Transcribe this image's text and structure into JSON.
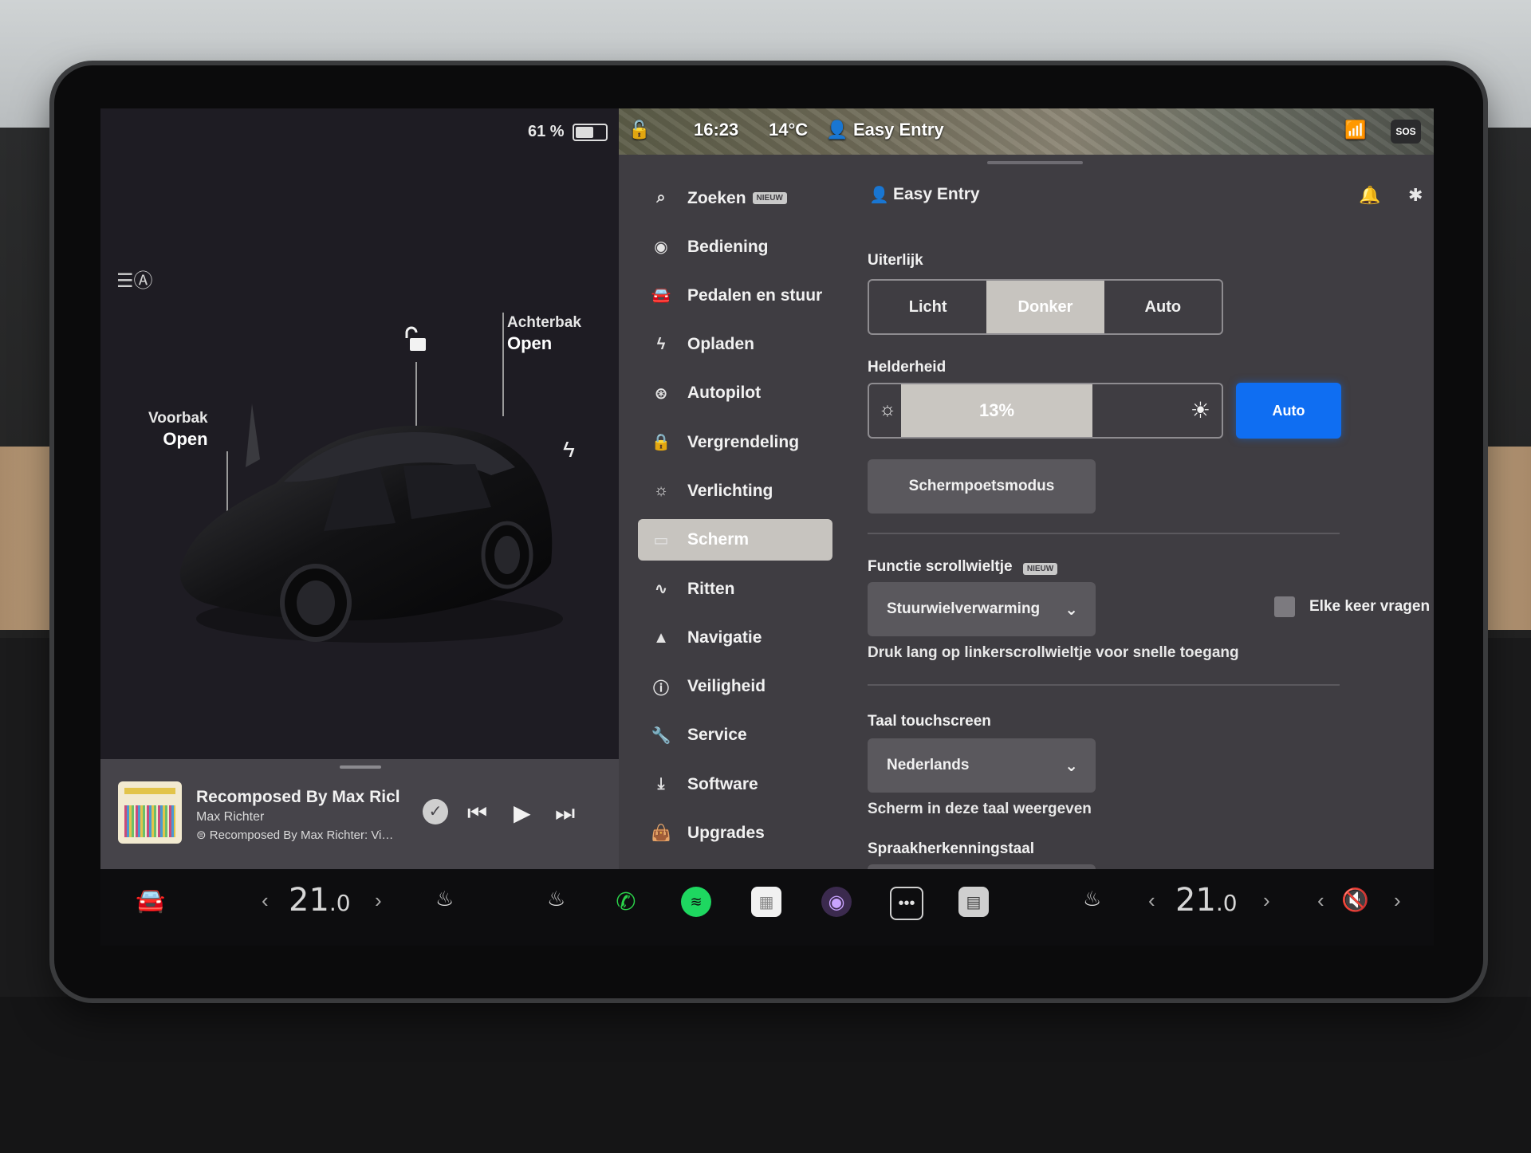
{
  "car": {
    "battery_percent": "61 %",
    "battery_level": 0.61,
    "frunk": {
      "label": "Voorbak",
      "state": "Open"
    },
    "trunk": {
      "label": "Achterbak",
      "state": "Open"
    }
  },
  "media": {
    "title": "Recomposed By Max Ricl",
    "artist": "Max Richter",
    "source": "Recomposed By Max Richter: Vi…"
  },
  "status": {
    "time": "16:23",
    "temperature": "14°C",
    "profile": "Easy Entry",
    "sos": "SOS"
  },
  "menu": {
    "items": [
      {
        "label": "Zoeken",
        "icon": "search-icon",
        "badge": "NIEUW"
      },
      {
        "label": "Bediening",
        "icon": "toggle-icon"
      },
      {
        "label": "Pedalen en stuur",
        "icon": "car-icon"
      },
      {
        "label": "Opladen",
        "icon": "bolt-icon"
      },
      {
        "label": "Autopilot",
        "icon": "steering-wheel-icon"
      },
      {
        "label": "Vergrendeling",
        "icon": "lock-icon"
      },
      {
        "label": "Verlichting",
        "icon": "sun-icon"
      },
      {
        "label": "Scherm",
        "icon": "screen-icon",
        "active": true
      },
      {
        "label": "Ritten",
        "icon": "route-icon"
      },
      {
        "label": "Navigatie",
        "icon": "navigation-icon"
      },
      {
        "label": "Veiligheid",
        "icon": "alert-icon"
      },
      {
        "label": "Service",
        "icon": "wrench-icon"
      },
      {
        "label": "Software",
        "icon": "download-icon"
      },
      {
        "label": "Upgrades",
        "icon": "bag-icon"
      }
    ]
  },
  "settings": {
    "profile_name": "Easy Entry",
    "appearance": {
      "label": "Uiterlijk",
      "options": [
        "Licht",
        "Donker",
        "Auto"
      ],
      "selected": "Donker"
    },
    "brightness": {
      "label": "Helderheid",
      "value_text": "13%",
      "value": 0.13,
      "auto_label": "Auto"
    },
    "screen_clean_label": "Schermpoetsmodus",
    "scroll_function": {
      "label": "Functie scrollwieltje",
      "badge": "NIEUW",
      "selected": "Stuurwielverwarming",
      "ask_each_time": "Elke keer vragen",
      "hint": "Druk lang op linkerscrollwieltje voor snelle toegang"
    },
    "touch_language": {
      "label": "Taal touchscreen",
      "selected": "Nederlands",
      "hint": "Scherm in deze taal weergeven"
    },
    "speech_language": {
      "label": "Spraakherkenningstaal"
    }
  },
  "dock": {
    "driver_temp": "21",
    "driver_temp_decimal": ".0",
    "passenger_temp": "21",
    "passenger_temp_decimal": ".0"
  },
  "colors": {
    "accent_blue": "#0f6ef2",
    "phone_green": "#2bd34a",
    "spotify_green": "#1ed760"
  }
}
